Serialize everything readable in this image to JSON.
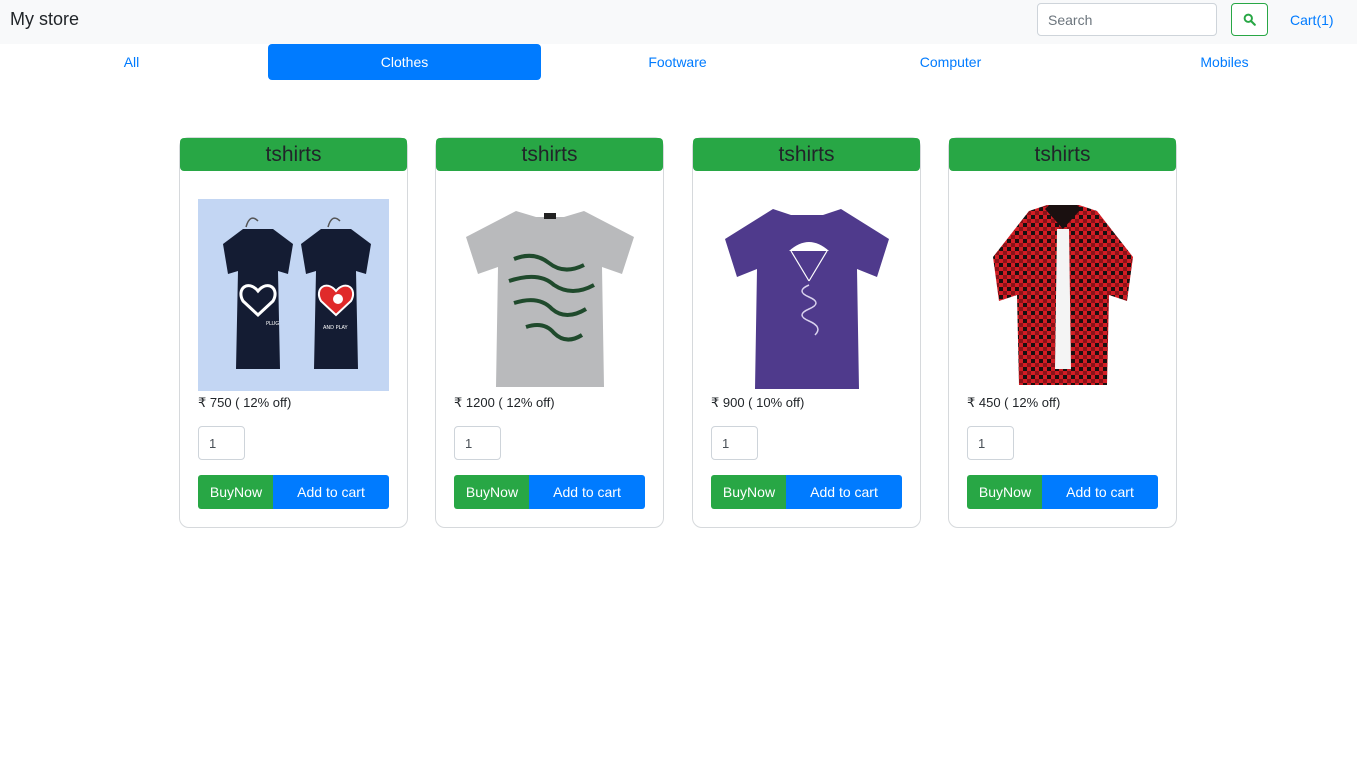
{
  "navbar": {
    "brand": "My store",
    "search_placeholder": "Search",
    "search_button_icon": "search-icon",
    "cart_label": "Cart(1)"
  },
  "tabs": [
    {
      "label": "All",
      "active": false
    },
    {
      "label": "Clothes",
      "active": true
    },
    {
      "label": "Footware",
      "active": false
    },
    {
      "label": "Computer",
      "active": false
    },
    {
      "label": "Mobiles",
      "active": false
    }
  ],
  "products": [
    {
      "title": "tshirts",
      "price": "₹ 750 ( 12% off)",
      "quantity": "1",
      "image": "couple-navy-tshirts"
    },
    {
      "title": "tshirts",
      "price": "₹ 1200 ( 12% off)",
      "quantity": "1",
      "image": "grey-lettered-tshirt"
    },
    {
      "title": "tshirts",
      "price": "₹ 900 ( 10% off)",
      "quantity": "1",
      "image": "purple-parachute-tshirt"
    },
    {
      "title": "tshirts",
      "price": "₹ 450 ( 12% off)",
      "quantity": "1",
      "image": "red-check-shirt"
    }
  ],
  "buttons": {
    "buy_now": "BuyNow",
    "add_to_cart": "Add to cart"
  },
  "colors": {
    "primary": "#007bff",
    "success": "#28a745",
    "navbar_bg": "#f8f9fa"
  }
}
